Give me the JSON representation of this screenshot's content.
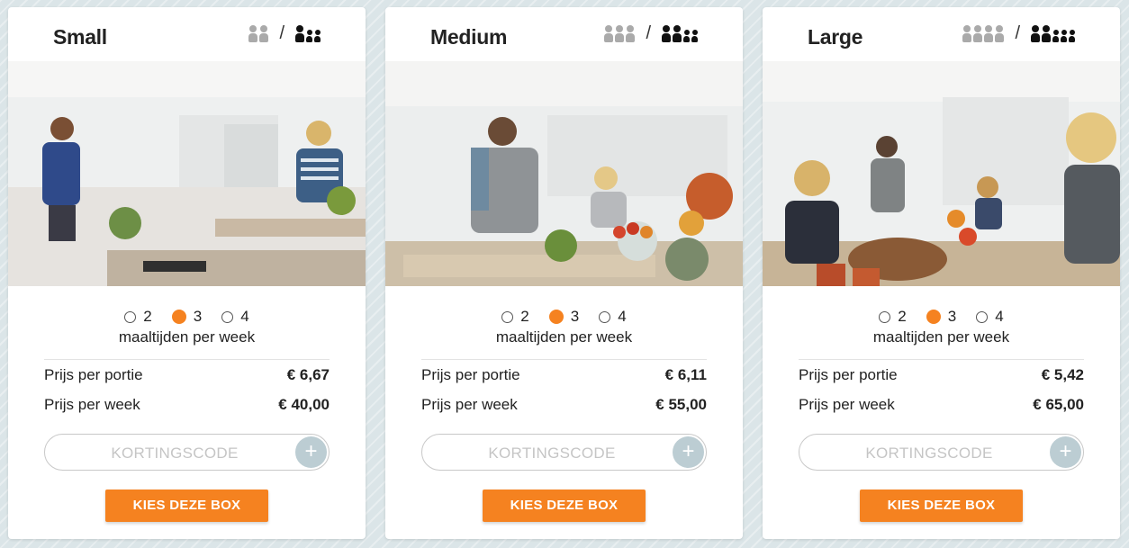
{
  "colors": {
    "accent": "#f58220",
    "plus_button": "#bccdd3",
    "background": "#dbe5e8"
  },
  "boxes": [
    {
      "title": "Small",
      "grey_people": 2,
      "black_people": 3,
      "photo": "kitchen-couple-cooking",
      "options": [
        "2",
        "3",
        "4"
      ],
      "selected": "3",
      "caption": "maaltijden per week",
      "portion_label": "Prijs per portie",
      "portion_price": "€ 6,67",
      "week_label": "Prijs per week",
      "week_price": "€ 40,00",
      "coupon_placeholder": "KORTINGSCODE",
      "plus": "+",
      "cta": "KIES DEZE BOX"
    },
    {
      "title": "Medium",
      "grey_people": 3,
      "black_people": 4,
      "photo": "father-daughter-cooking",
      "options": [
        "2",
        "3",
        "4"
      ],
      "selected": "3",
      "caption": "maaltijden per week",
      "portion_label": "Prijs per portie",
      "portion_price": "€ 6,11",
      "week_label": "Prijs per week",
      "week_price": "€ 55,00",
      "coupon_placeholder": "KORTINGSCODE",
      "plus": "+",
      "cta": "KIES DEZE BOX"
    },
    {
      "title": "Large",
      "grey_people": 4,
      "black_people": 6,
      "photo": "family-dinner-table",
      "options": [
        "2",
        "3",
        "4"
      ],
      "selected": "3",
      "caption": "maaltijden per week",
      "portion_label": "Prijs per portie",
      "portion_price": "€ 5,42",
      "week_label": "Prijs per week",
      "week_price": "€ 65,00",
      "coupon_placeholder": "KORTINGSCODE",
      "plus": "+",
      "cta": "KIES DEZE BOX"
    }
  ]
}
